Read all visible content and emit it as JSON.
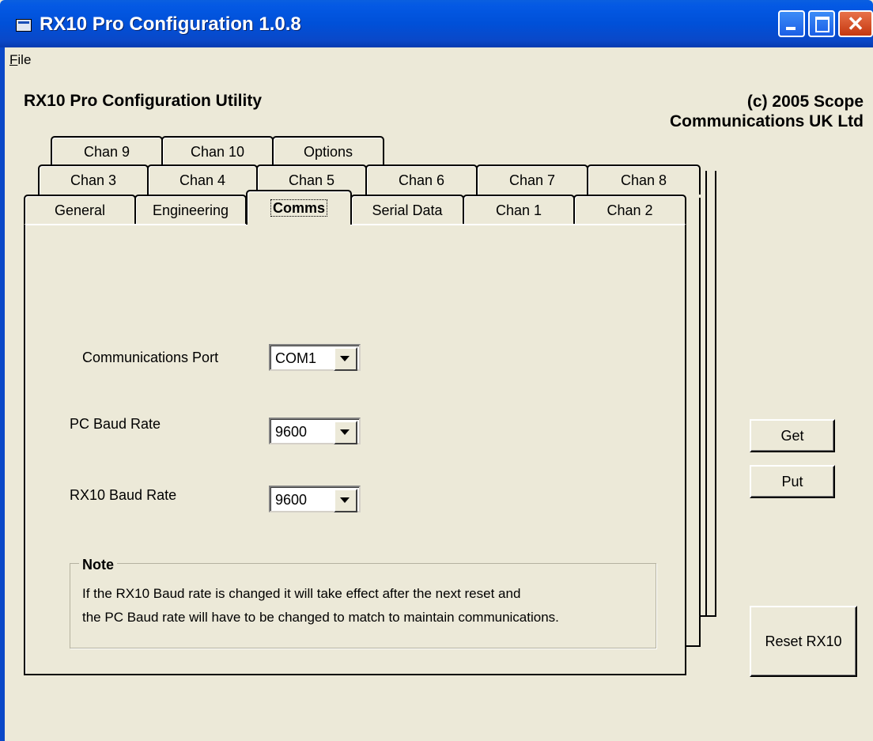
{
  "window": {
    "title": "RX10 Pro Configuration 1.0.8"
  },
  "menu": {
    "file": "File"
  },
  "header": {
    "heading": "RX10 Pro Configuration Utility",
    "copyright_line1": "(c) 2005 Scope",
    "copyright_line2": "Communications UK Ltd"
  },
  "tabs": {
    "row_top": [
      "Chan 9",
      "Chan 10",
      "Options"
    ],
    "row_middle": [
      "Chan 3",
      "Chan 4",
      "Chan 5",
      "Chan 6",
      "Chan 7",
      "Chan 8"
    ],
    "row_front": [
      "General",
      "Engineering",
      "Comms",
      "Serial Data",
      "Chan 1",
      "Chan 2"
    ],
    "selected": "Comms"
  },
  "comms": {
    "port_label": "Communications Port",
    "port_value": "COM1",
    "pc_baud_label": "PC Baud Rate",
    "pc_baud_value": "9600",
    "rx10_baud_label": "RX10 Baud Rate",
    "rx10_baud_value": "9600"
  },
  "note": {
    "title": "Note",
    "line1": "If the RX10 Baud rate is changed it will take effect after the next reset and",
    "line2": "the PC Baud rate will have to be changed to match to maintain communications."
  },
  "buttons": {
    "get": "Get",
    "put": "Put",
    "reset": "Reset RX10"
  }
}
